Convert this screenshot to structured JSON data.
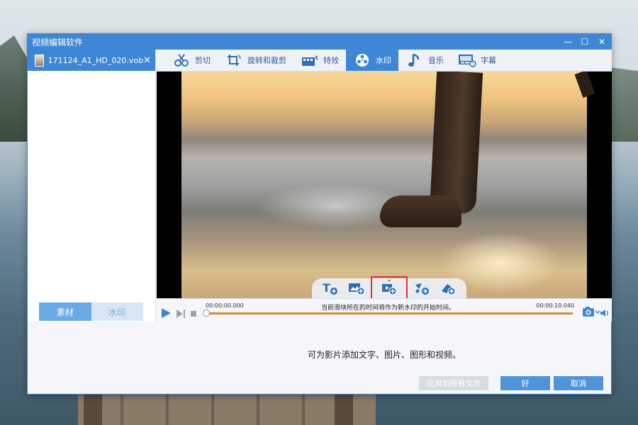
{
  "window": {
    "title": "视频编辑软件",
    "minimize": "—",
    "maximize": "☐",
    "close": "✕"
  },
  "file": {
    "name": "171124_A1_HD_020.vob",
    "close": "✕"
  },
  "tool_tabs": [
    {
      "label": "剪切",
      "icon": "scissors-icon"
    },
    {
      "label": "旋转和裁剪",
      "icon": "crop-rotate-icon"
    },
    {
      "label": "特效",
      "icon": "effects-icon"
    },
    {
      "label": "水印",
      "icon": "watermark-icon",
      "active": true
    },
    {
      "label": "音乐",
      "icon": "music-icon"
    },
    {
      "label": "字幕",
      "icon": "subtitle-icon"
    }
  ],
  "side_tabs": {
    "material": "素材",
    "watermark": "水印"
  },
  "watermark_tools": [
    "add-text-icon",
    "add-image-icon",
    "add-video-icon",
    "add-shape-icon",
    "add-eraser-icon"
  ],
  "timeline": {
    "start": "00:00:00.000",
    "end": "00:00:10.040",
    "hint": "当前滑块所在的时间将作为新水印的开始时间。",
    "position": 0
  },
  "bottom": {
    "hint": "可为影片添加文字、图片、图形和视频。",
    "apply_all": "应用到所有文件",
    "ok": "好",
    "cancel": "取消"
  },
  "colors": {
    "accent": "#3d87d6",
    "track": "#e08a2f",
    "highlight": "#e03030"
  }
}
